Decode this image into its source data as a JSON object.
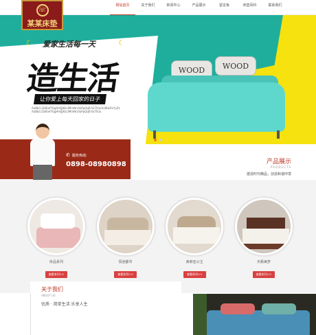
{
  "header": {
    "logo_text": "某某床垫",
    "nav": [
      "网站首页",
      "关于我们",
      "新闻中心",
      "产品展示",
      "留言板",
      "床垫百科",
      "联系我们"
    ]
  },
  "hero": {
    "slogan_top": "爱家生活每一天",
    "big_title": "造生活",
    "sub_slogan": "让你爱上每天回家的日子",
    "small_text": "AaBbCcDdEeFfGgHhIiJjKkLlMmNnOoPpQqRrSsTtUuVvWwXxYyZz AaBbCcDdEeFfGgHhIiJjKkLlMmNnOoPpQqRrSsTtUu",
    "pillow_text": "WOOD",
    "dots": 2,
    "active_dot": 0
  },
  "hotline": {
    "label": "服务热线:",
    "number": "0898-08980898"
  },
  "products": {
    "title": "产品展示",
    "title_en": "PRODUCTS",
    "desc": "建造时代精品，创造和谐环境",
    "items": [
      {
        "name": "床品系列",
        "button": "查看系列>>"
      },
      {
        "name": "情迷都市",
        "button": "查看系列>>"
      },
      {
        "name": "索菲亚公主",
        "button": "查看系列>>"
      },
      {
        "name": "天籁美梦",
        "button": "查看系列>>"
      }
    ]
  },
  "about": {
    "title": "关于我们",
    "title_en": "ABOUT US",
    "slogan": "优质 · 简单生活 乐享人生"
  },
  "colors": {
    "brand_red": "#9a2a17",
    "accent_red": "#d94040",
    "teal": "#1fae9c",
    "yellow": "#f5e20e"
  }
}
